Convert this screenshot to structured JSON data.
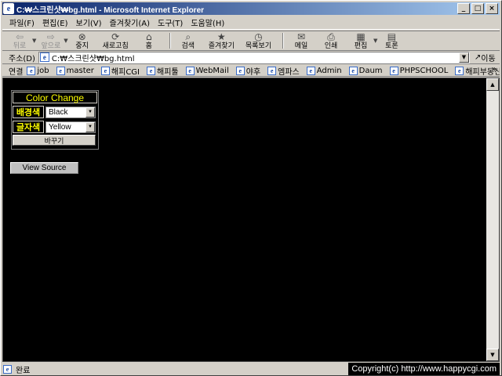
{
  "window": {
    "title": "C:₩스크린샷₩bg.html - Microsoft Internet Explorer",
    "controls": [
      "_",
      "□",
      "×"
    ]
  },
  "menu": [
    "파일(F)",
    "편집(E)",
    "보기(V)",
    "즐겨찾기(A)",
    "도구(T)",
    "도움말(H)"
  ],
  "toolbar": {
    "back": "뒤로",
    "forward": "앞으로",
    "stop": "중지",
    "refresh": "새로고침",
    "home": "홈",
    "search": "검색",
    "favorites": "즐겨찾기",
    "history": "목록보기",
    "mail": "메일",
    "print": "인쇄",
    "edit": "편집",
    "discuss": "토론"
  },
  "address": {
    "label": "주소(D)",
    "value": "C:₩스크린샷₩bg.html",
    "go": "이동"
  },
  "links": {
    "label": "연결",
    "items": [
      "job",
      "master",
      "해피CGI",
      "해피툴",
      "WebMail",
      "야후",
      "엠파스",
      "Admin",
      "Daum",
      "PHPSCHOOL",
      "해피부동산"
    ]
  },
  "page": {
    "form_title": "Color Change",
    "bg_label": "배경색",
    "bg_value": "Black",
    "text_label": "글자색",
    "text_value": "Yellow",
    "submit_label": "바꾸기",
    "view_source": "View Source"
  },
  "status": {
    "text": "완료",
    "copyright": "Copyright(c) http://www.happycgi.com"
  },
  "colors": {
    "page_bg": "#000000",
    "page_text": "#ffff00",
    "title_start": "#0a246a",
    "title_end": "#a6caf0"
  }
}
